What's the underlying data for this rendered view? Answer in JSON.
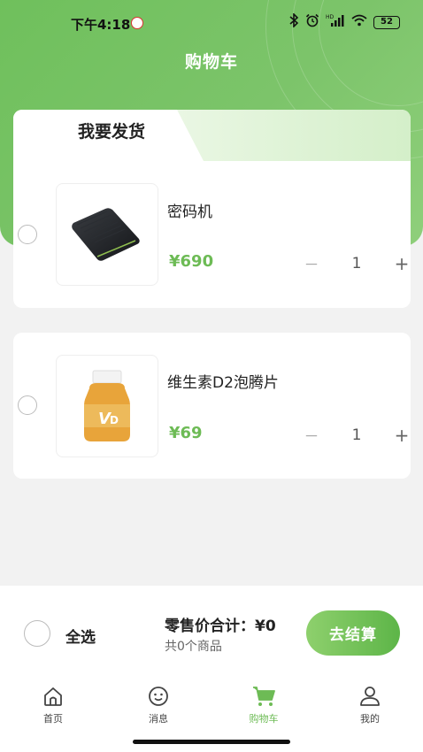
{
  "status_bar": {
    "time": "下午4:18",
    "hd_label": "HD",
    "battery": "52"
  },
  "header": {
    "title": "购物车"
  },
  "cart_section": {
    "tab_label": "我要发货"
  },
  "items": [
    {
      "name": "密码机",
      "price": "¥690",
      "quantity": "1",
      "minus": "－",
      "plus": "+"
    },
    {
      "name": "维生素D2泡腾片",
      "price": "¥69",
      "quantity": "1",
      "minus": "－",
      "plus": "+"
    }
  ],
  "footer": {
    "select_all_label": "全选",
    "total_label": "零售价合计：¥0",
    "count_label": "共0个商品",
    "checkout_label": "去结算"
  },
  "nav": [
    {
      "label": "首页",
      "icon": "home-icon"
    },
    {
      "label": "消息",
      "icon": "message-icon"
    },
    {
      "label": "购物车",
      "icon": "cart-icon",
      "active": true
    },
    {
      "label": "我的",
      "icon": "profile-icon"
    }
  ],
  "colors": {
    "accent": "#6dbb55",
    "hero": "#78c465"
  }
}
